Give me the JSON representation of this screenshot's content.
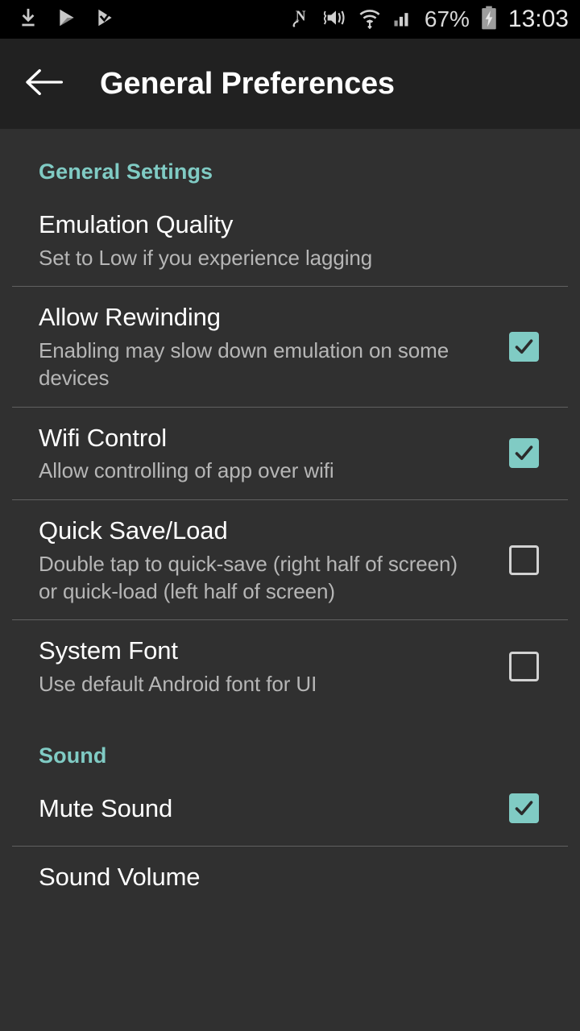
{
  "status_bar": {
    "left_icons": [
      {
        "name": "download-complete-icon",
        "label": "download complete"
      },
      {
        "name": "play-store-icon",
        "label": "play store"
      },
      {
        "name": "play-store-update-icon",
        "label": "play store update"
      }
    ],
    "right_icons": [
      {
        "name": "nfc-icon",
        "label": "NFC"
      },
      {
        "name": "mute-vibrate-icon",
        "label": "silent vibrate"
      },
      {
        "name": "wifi-icon",
        "label": "wifi"
      },
      {
        "name": "cellular-signal-icon",
        "label": "cellular signal"
      }
    ],
    "battery_percent": "67%",
    "battery_icon": "battery-charging-icon",
    "clock": "13:03"
  },
  "toolbar": {
    "back_icon": "arrow-back-icon",
    "title": "General Preferences"
  },
  "colors": {
    "accent": "#80cbc4",
    "background": "#303030",
    "toolbar_background": "#212121",
    "status_background": "#000000",
    "title_text": "#ffffff",
    "summary_text": "#b6b6b6",
    "divider": "#8a8a8a"
  },
  "sections": [
    {
      "header": "General Settings",
      "items": [
        {
          "title": "Emulation Quality",
          "summary": "Set to Low if you experience lagging",
          "widget": "none",
          "checked": null
        },
        {
          "title": "Allow Rewinding",
          "summary": "Enabling may slow down emulation on some devices",
          "widget": "checkbox",
          "checked": true
        },
        {
          "title": "Wifi Control",
          "summary": "Allow controlling of app over wifi",
          "widget": "checkbox",
          "checked": true
        },
        {
          "title": "Quick Save/Load",
          "summary": "Double tap to quick-save (right half of screen) or quick-load (left half of screen)",
          "widget": "checkbox",
          "checked": false
        },
        {
          "title": "System Font",
          "summary": "Use default Android font for UI",
          "widget": "checkbox",
          "checked": false
        }
      ]
    },
    {
      "header": "Sound",
      "items": [
        {
          "title": "Mute Sound",
          "summary": "",
          "widget": "checkbox",
          "checked": true
        },
        {
          "title": "Sound Volume",
          "summary": "",
          "widget": "none",
          "checked": null
        }
      ]
    }
  ]
}
